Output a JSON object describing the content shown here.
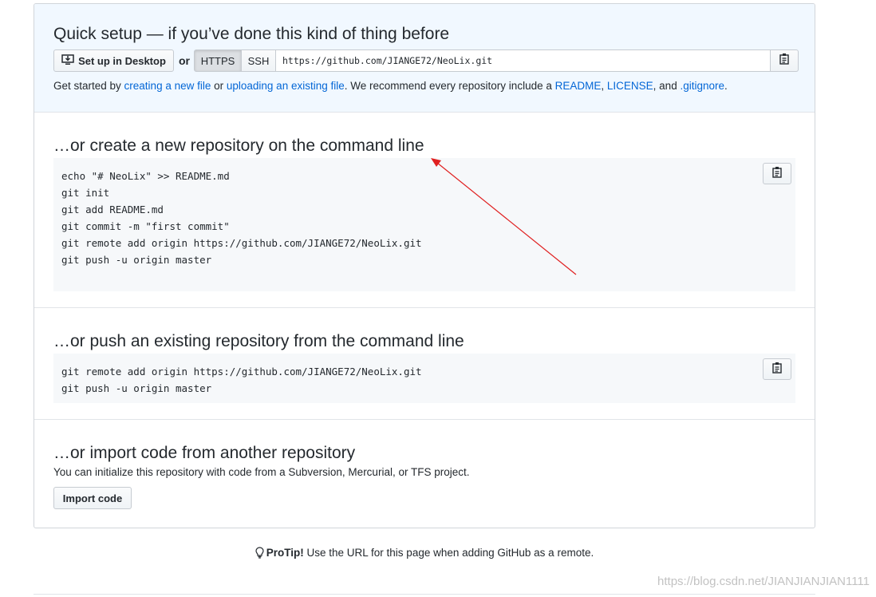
{
  "quick_setup": {
    "title": "Quick setup — if you’ve done this kind of thing before",
    "desktop_button": "Set up in Desktop",
    "or_label": "or",
    "https_label": "HTTPS",
    "ssh_label": "SSH",
    "clone_url": "https://github.com/JIANGE72/NeoLix.git",
    "help": {
      "prefix": "Get started by ",
      "link_new_file": "creating a new file",
      "middle": " or ",
      "link_upload": "uploading an existing file",
      "middle2": ". We recommend every repository include a ",
      "link_readme": "README",
      "comma1": ", ",
      "link_license": "LICENSE",
      "and_text": ", and ",
      "link_gitignore": ".gitignore",
      "suffix": "."
    }
  },
  "create_section": {
    "title": "…or create a new repository on the command line",
    "lines": [
      "echo \"# NeoLix\" >> README.md",
      "git init",
      "git add README.md",
      "git commit -m \"first commit\"",
      "git remote add origin https://github.com/JIANGE72/NeoLix.git",
      "git push -u origin master"
    ]
  },
  "push_section": {
    "title": "…or push an existing repository from the command line",
    "lines": [
      "git remote add origin https://github.com/JIANGE72/NeoLix.git",
      "git push -u origin master"
    ]
  },
  "import_section": {
    "title": "…or import code from another repository",
    "description": "You can initialize this repository with code from a Subversion, Mercurial, or TFS project.",
    "button": "Import code"
  },
  "protip": {
    "label": "ProTip!",
    "text": " Use the URL for this page when adding GitHub as a remote."
  },
  "watermark": "https://blog.csdn.net/JIANJIANJIAN1111",
  "colors": {
    "link": "#0366d6",
    "quick_bg": "#f1f8ff",
    "code_bg": "#f6f8fa",
    "annotation_arrow": "#e02020"
  }
}
